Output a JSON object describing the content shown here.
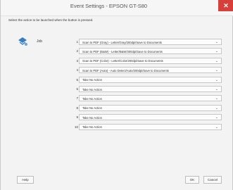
{
  "window": {
    "title": "Event Settings - EPSON GT-S80"
  },
  "instruction": "Select the action to be launched when the button is pressed.",
  "job": {
    "label": "Job",
    "icon": "scanner-job-icon"
  },
  "rows": [
    {
      "num": "1",
      "value": "Scan to PDF (Gray) - Letter/Gray/200dpi/Save to Documents"
    },
    {
      "num": "2",
      "value": "Scan to PDF (B&W) - Letter/B&W/300dpi/Save to Documents"
    },
    {
      "num": "3",
      "value": "Scan to PDF (Color) - Letter/Color/200dpi/Save to Documents"
    },
    {
      "num": "4",
      "value": "Scan to PDF (Auto) - Auto Detect/Auto/200dpi/Save to Documents"
    },
    {
      "num": "5",
      "value": "Take No Action"
    },
    {
      "num": "6",
      "value": "Take No Action"
    },
    {
      "num": "7",
      "value": "Take No Action"
    },
    {
      "num": "8",
      "value": "Take No Action"
    },
    {
      "num": "9",
      "value": "Take No Action"
    },
    {
      "num": "10",
      "value": "Take No Action"
    }
  ],
  "buttons": {
    "help": "Help",
    "ok": "OK",
    "cancel": "Cancel"
  },
  "colors": {
    "close_button": "#d7403a",
    "window_bg": "#f3f3f3",
    "icon_blue": "#3a7cc0"
  }
}
